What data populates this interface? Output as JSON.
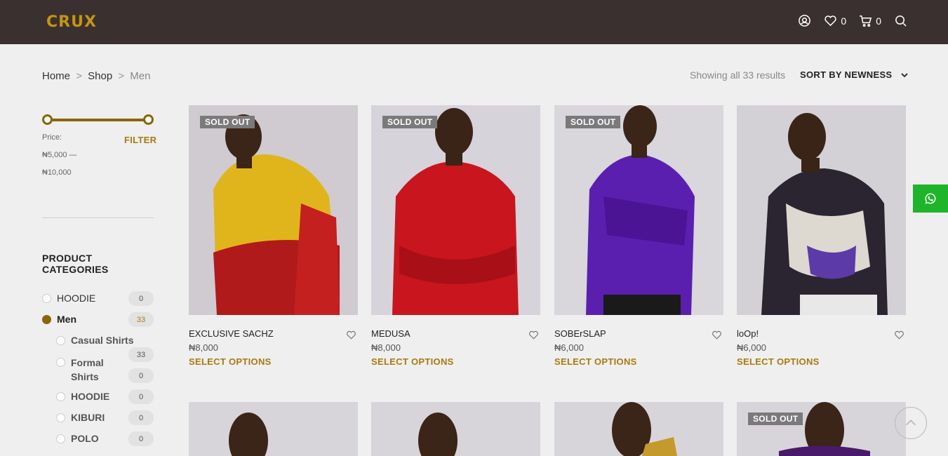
{
  "header": {
    "logo": "CRUX",
    "wishlist_count": "0",
    "cart_count": "0"
  },
  "breadcrumb": {
    "home": "Home",
    "sep1": ">",
    "shop": "Shop",
    "sep2": ">",
    "current": "Men"
  },
  "toolbar": {
    "results_text": "Showing all 33 results",
    "sort_label": "SORT BY NEWNESS"
  },
  "filter": {
    "price_label": "Price:",
    "range_min": "₦5,000 —",
    "range_max": "₦10,000",
    "button": "FILTER"
  },
  "categories": {
    "title": "PRODUCT CATEGORIES",
    "items": [
      {
        "label": "HOODIE",
        "count": "0",
        "selected": false
      },
      {
        "label": "Men",
        "count": "33",
        "selected": true
      },
      {
        "label": "Casual Shirts",
        "count": "33",
        "selected": false
      },
      {
        "label": "Formal Shirts",
        "count": "0",
        "selected": false
      },
      {
        "label": "HOODIE",
        "count": "0",
        "selected": false
      },
      {
        "label": "KIBURI",
        "count": "0",
        "selected": false
      },
      {
        "label": "POLO",
        "count": "0",
        "selected": false
      }
    ]
  },
  "products": [
    {
      "name": "EXCLUSIVE SACHZ",
      "price": "₦8,000",
      "action": "SELECT OPTIONS",
      "badge": "SOLD OUT"
    },
    {
      "name": "MEDUSA",
      "price": "₦8,000",
      "action": "SELECT OPTIONS",
      "badge": "SOLD OUT"
    },
    {
      "name": "SOBErSLAP",
      "price": "₦6,000",
      "action": "SELECT OPTIONS",
      "badge": "SOLD OUT"
    },
    {
      "name": "loOp!",
      "price": "₦6,000",
      "action": "SELECT OPTIONS",
      "badge": ""
    },
    {
      "badge": ""
    },
    {
      "badge": ""
    },
    {
      "badge": ""
    },
    {
      "badge": "SOLD OUT"
    }
  ],
  "colors": {
    "header_bg": "#3b3030",
    "accent": "#a87a10",
    "whatsapp": "#1fb52a"
  }
}
